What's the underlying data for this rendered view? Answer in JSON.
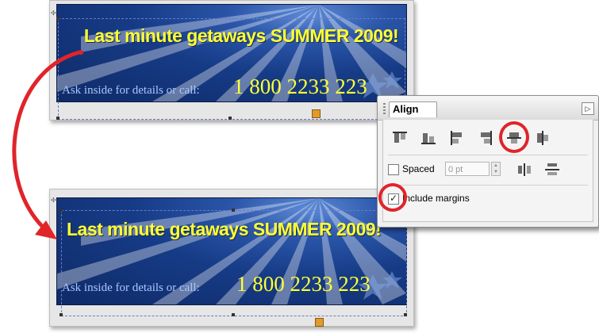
{
  "banner": {
    "headline": "Last minute getaways SUMMER 2009!",
    "subtext": "Ask inside for details or call:",
    "phone": "1 800 2233 223"
  },
  "banner_after": {
    "headline": "Last minute getaways SUMMER 2009!",
    "subtext": "Ask inside for details or call:",
    "phone": "1 800 2233 223"
  },
  "align_panel": {
    "tab_label": "Align",
    "spaced_label": "Spaced",
    "spaced_value": "0 pt",
    "include_margins_label": "Include margins",
    "include_margins_checked": true,
    "spaced_checked": false,
    "icons": [
      "align-top-icon",
      "align-bottom-icon",
      "align-left-icon",
      "align-right-icon",
      "align-vertical-center-icon",
      "align-horizontal-center-icon",
      "distribute-horizontally-icon",
      "distribute-vertically-icon"
    ]
  },
  "colors": {
    "highlight_red": "#e0242a",
    "headline_yellow": "#ffff33",
    "banner_blue": "#163b86"
  }
}
